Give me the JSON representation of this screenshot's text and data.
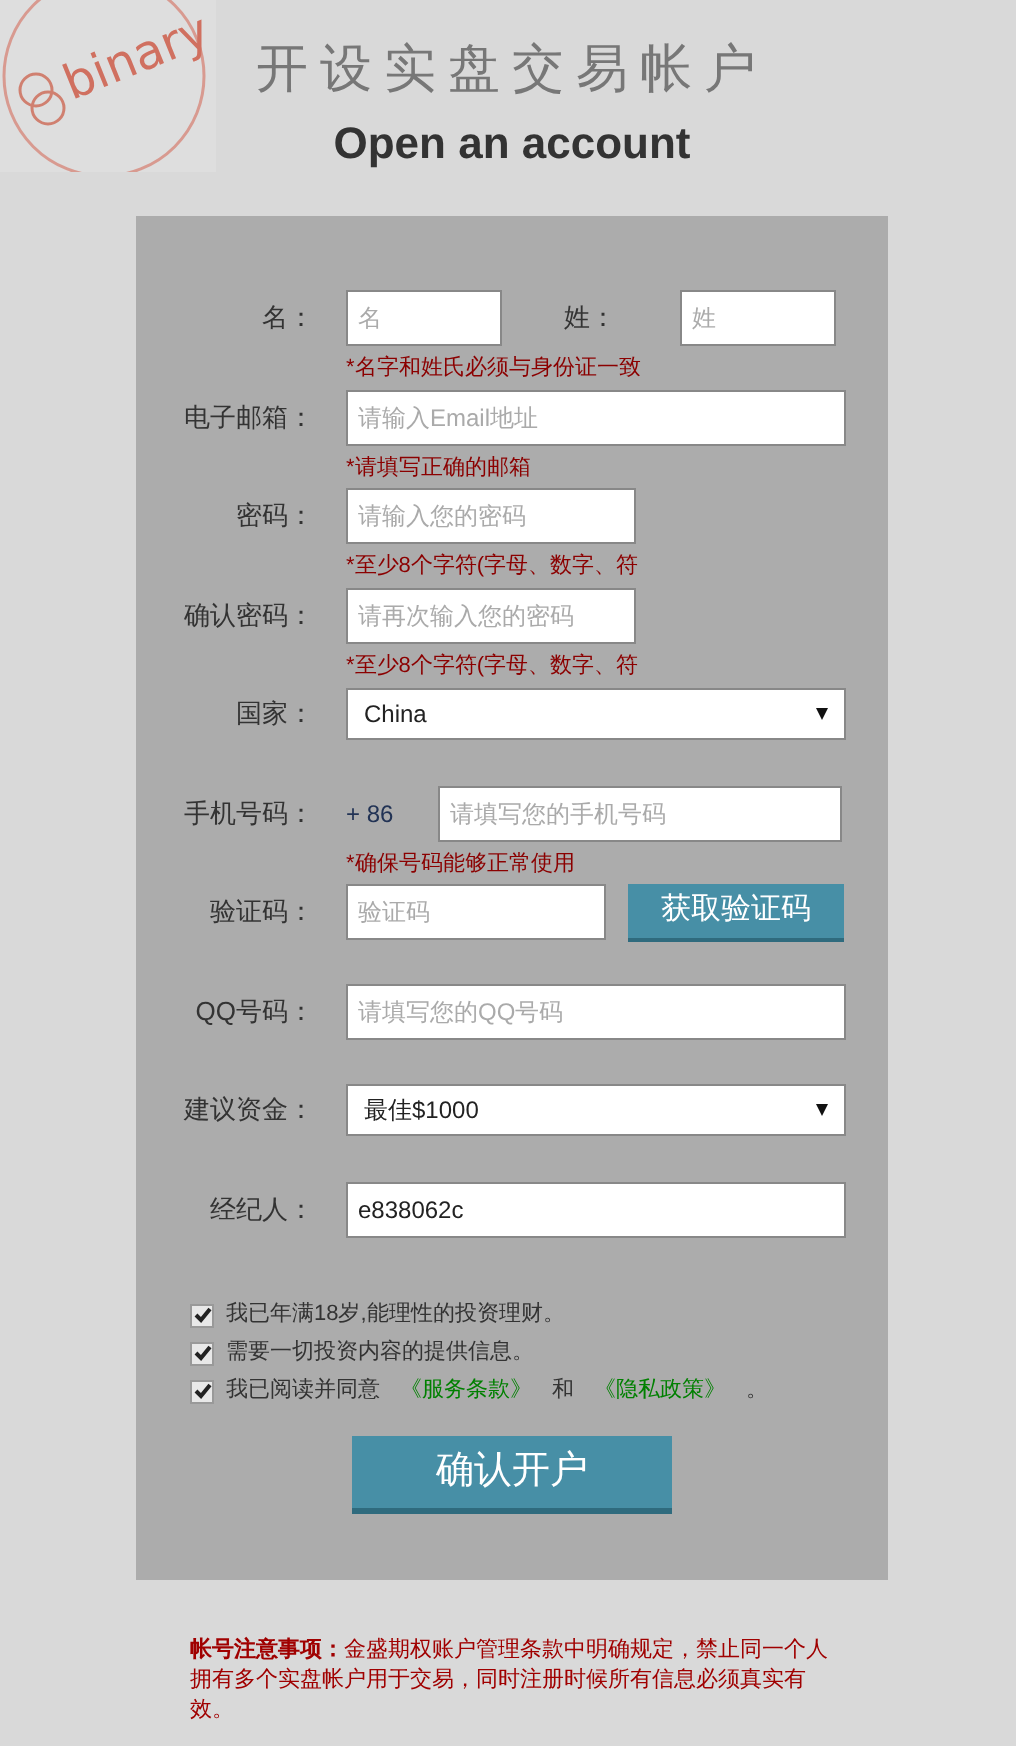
{
  "header": {
    "logo_text": "binary",
    "title_zh": "开设实盘交易帐户",
    "title_en": "Open an account"
  },
  "form": {
    "rows": [
      {
        "kind": "pair",
        "fields": [
          {
            "label": "名：",
            "placeholder": "名"
          },
          {
            "label": "姓：",
            "placeholder": "姓"
          }
        ],
        "hint": "*名字和姓氏必须与身份证一致"
      },
      {
        "kind": "input",
        "label": "电子邮箱：",
        "placeholder": "请输入Email地址",
        "hint": "*请填写正确的邮箱"
      },
      {
        "kind": "input_short",
        "label": "密码：",
        "placeholder": "请输入您的密码",
        "hint": "*至少8个字符(字母、数字、符"
      },
      {
        "kind": "input_short",
        "label": "确认密码：",
        "placeholder": "请再次输入您的密码",
        "hint": "*至少8个字符(字母、数字、符"
      },
      {
        "kind": "select",
        "label": "国家：",
        "value": "China"
      },
      {
        "kind": "phone",
        "label": "手机号码：",
        "prefix": "+ 86",
        "placeholder": "请填写您的手机号码",
        "hint": "*确保号码能够正常使用"
      },
      {
        "kind": "verify",
        "label": "验证码：",
        "placeholder": "验证码",
        "button": "获取验证码"
      },
      {
        "kind": "input",
        "label": "QQ号码：",
        "placeholder": "请填写您的QQ号码"
      },
      {
        "kind": "select",
        "label": "建议资金：",
        "value": "最佳$1000"
      },
      {
        "kind": "input",
        "label": "经纪人：",
        "value": "e838062c"
      }
    ],
    "agreements": [
      {
        "checked": true,
        "segments": [
          {
            "kind": "text",
            "text": "我已年满18岁,能理性的投资理财。"
          }
        ]
      },
      {
        "checked": true,
        "segments": [
          {
            "kind": "text",
            "text": "需要一切投资内容的提供信息。"
          }
        ]
      },
      {
        "checked": true,
        "segments": [
          {
            "kind": "text",
            "text": "我已阅读并同意"
          },
          {
            "kind": "link",
            "text": "《服务条款》"
          },
          {
            "kind": "text",
            "text": "和"
          },
          {
            "kind": "link",
            "text": "《隐私政策》"
          },
          {
            "kind": "text",
            "text": "。"
          }
        ]
      }
    ],
    "submit": "确认开户"
  },
  "notice": "**帐号注意事项：**金盛期权账户管理条款中明确规定，禁止同一个人拥有多个实盘帐户用于交易，同时注册时候所有信息必须真实有效。"
}
